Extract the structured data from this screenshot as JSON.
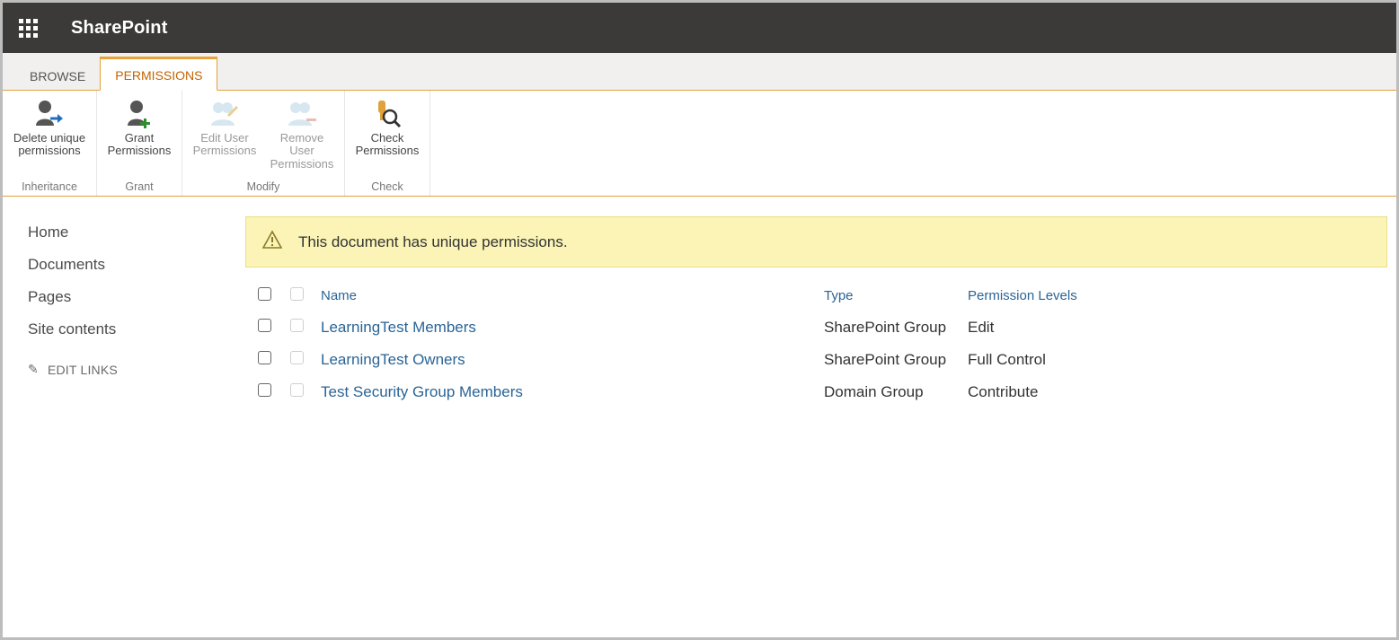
{
  "suite": {
    "brand": "SharePoint"
  },
  "ribbon_tabs": {
    "browse": "BROWSE",
    "permissions": "PERMISSIONS"
  },
  "ribbon": {
    "groups": {
      "inheritance": {
        "label": "Inheritance",
        "delete_unique_l1": "Delete unique",
        "delete_unique_l2": "permissions"
      },
      "grant": {
        "label": "Grant",
        "grant_l1": "Grant",
        "grant_l2": "Permissions"
      },
      "modify": {
        "label": "Modify",
        "edit_user_l1": "Edit User",
        "edit_user_l2": "Permissions",
        "remove_user_l1": "Remove User",
        "remove_user_l2": "Permissions"
      },
      "check": {
        "label": "Check",
        "check_l1": "Check",
        "check_l2": "Permissions"
      }
    }
  },
  "nav": {
    "home": "Home",
    "documents": "Documents",
    "pages": "Pages",
    "site_contents": "Site contents",
    "edit_links": "EDIT LINKS"
  },
  "status": {
    "message": "This document has unique permissions."
  },
  "table": {
    "headers": {
      "name": "Name",
      "type": "Type",
      "permission_levels": "Permission Levels"
    },
    "rows": [
      {
        "name": "LearningTest Members",
        "type": "SharePoint Group",
        "level": "Edit"
      },
      {
        "name": "LearningTest Owners",
        "type": "SharePoint Group",
        "level": "Full Control"
      },
      {
        "name": "Test Security Group Members",
        "type": "Domain Group",
        "level": "Contribute"
      }
    ]
  }
}
